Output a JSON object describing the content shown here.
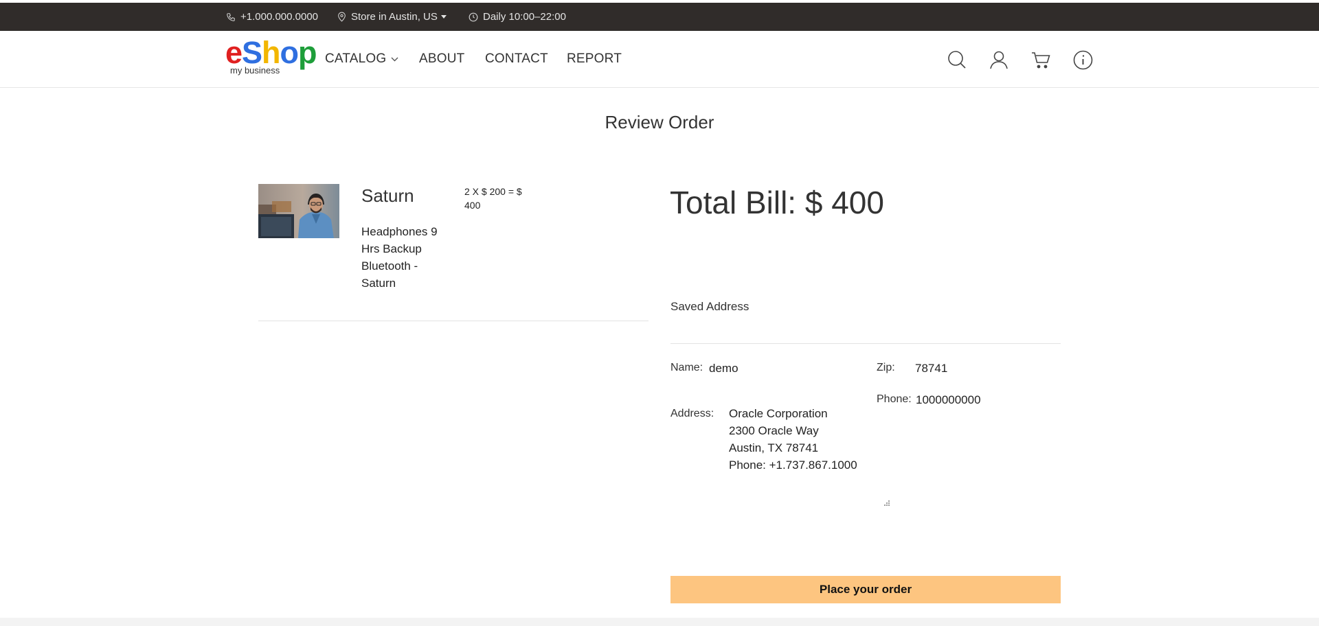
{
  "topbar": {
    "phone": "+1.000.000.0000",
    "store": "Store in Austin, US",
    "hours": "Daily 10:00–22:00"
  },
  "brand": {
    "letters": [
      {
        "char": "e",
        "color": "#e02020"
      },
      {
        "char": "S",
        "color": "#2f6fe0"
      },
      {
        "char": "h",
        "color": "#f2b600"
      },
      {
        "char": "o",
        "color": "#2f6fe0"
      },
      {
        "char": "p",
        "color": "#1e9e3a"
      }
    ],
    "tagline": "my business"
  },
  "nav": {
    "catalog": "CATALOG",
    "about": "ABOUT",
    "contact": "CONTACT",
    "report": "REPORT"
  },
  "page": {
    "title": "Review Order"
  },
  "order_item": {
    "name": "Saturn",
    "description": "Headphones 9 Hrs Backup Bluetooth - Saturn",
    "calculation": "2 X $ 200 = $ 400"
  },
  "summary": {
    "total_bill": "Total Bill: $ 400",
    "saved_address_label": "Saved Address"
  },
  "address": {
    "name_label": "Name:",
    "name_value": "demo",
    "zip_label": "Zip:",
    "zip_value": "78741",
    "phone_label": "Phone:",
    "phone_value": "1000000000",
    "address_label": "Address:",
    "address_lines": [
      "Oracle Corporation",
      "2300 Oracle Way",
      "Austin, TX 78741",
      "Phone: +1.737.867.1000"
    ]
  },
  "actions": {
    "place_order": "Place your order"
  },
  "colors": {
    "topbar": "#302c2a",
    "button": "#fdc580"
  },
  "icons": [
    "phone-icon",
    "location-pin-icon",
    "clock-icon",
    "search-icon",
    "user-icon",
    "cart-icon",
    "info-icon",
    "chevron-down-icon",
    "caret-down-icon"
  ]
}
